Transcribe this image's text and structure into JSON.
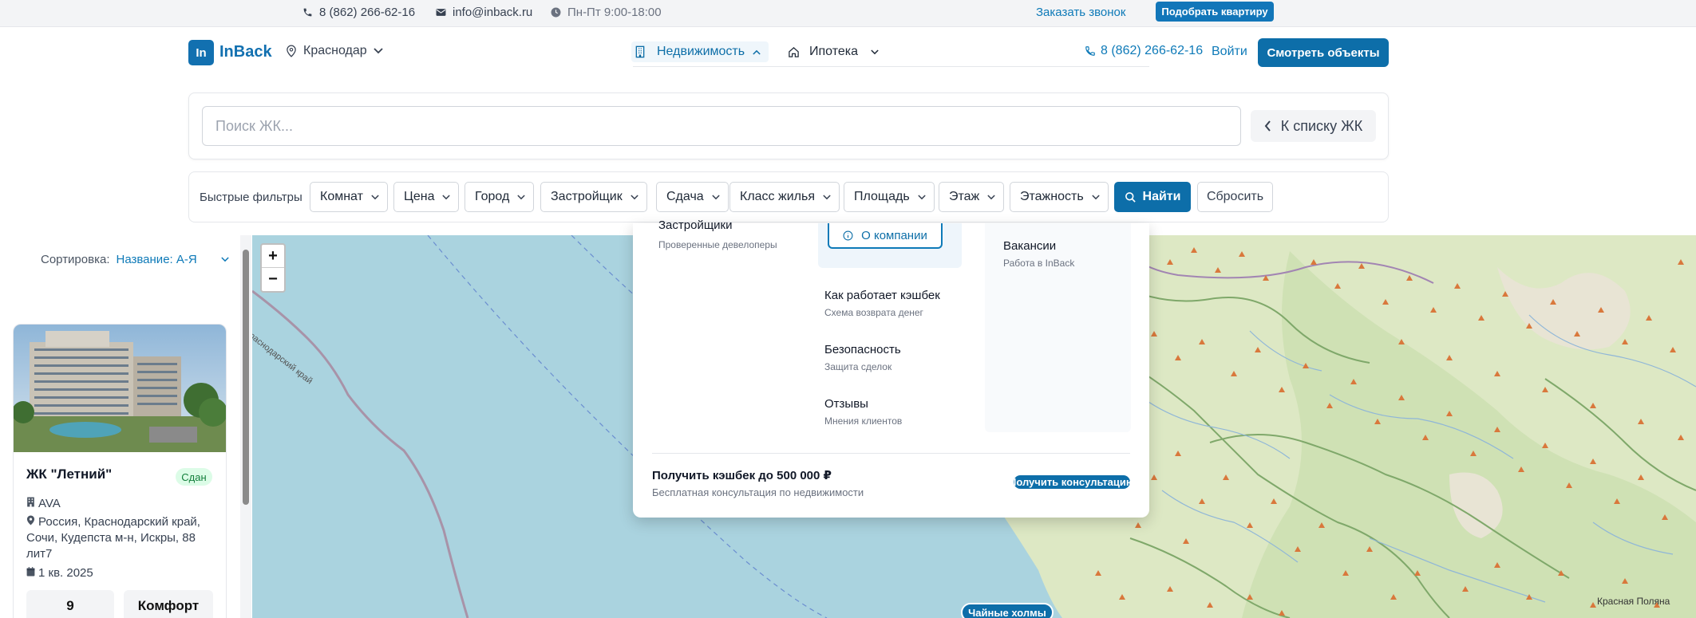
{
  "topbar": {
    "phone": "8 (862) 266-62-16",
    "email": "info@inback.ru",
    "hours": "Пн-Пт 9:00-18:00",
    "callback_link": "Заказать звонок",
    "pick_button": "Подобрать квартиру"
  },
  "header": {
    "logo_mark": "In",
    "logo_text": "InBack",
    "city": "Краснодар",
    "nav_realty": "Недвижимость",
    "nav_mortgage": "Ипотека",
    "phone": "8 (862) 266-62-16",
    "login": "Войти",
    "cta": "Смотреть объекты"
  },
  "search": {
    "placeholder": "Поиск ЖК...",
    "back_button": "К списку ЖК"
  },
  "filters": {
    "label": "Быстрые фильтры",
    "items": [
      "Комнат",
      "Цена",
      "Город",
      "Застройщик",
      "Сдача",
      "Класс жилья",
      "Площадь",
      "Этаж",
      "Этажность"
    ],
    "find": "Найти",
    "reset": "Сбросить"
  },
  "listing": {
    "sort_label": "Сортировка:",
    "sort_value": "Название: А-Я",
    "card": {
      "title": "ЖК \"Летний\"",
      "badge": "Сдан",
      "developer": "AVA",
      "address": "Россия, Краснодарский край, Сочи, Кудепста м-н, Искры, 88 лит7",
      "completion": "1 кв. 2025",
      "stat_count": "9",
      "stat_class": "Комфорт"
    }
  },
  "map": {
    "zoom_in": "+",
    "zoom_out": "−",
    "region_label": "Краснодарский край",
    "town_label": "Красная Поляна",
    "pill_label": "Чайные холмы"
  },
  "dropdown": {
    "developers_title": "Застройщики",
    "developers_sub": "Проверенные девелоперы",
    "about_button": "О компании",
    "cashback_title": "Как работает кэшбек",
    "cashback_sub": "Схема возврата денег",
    "security_title": "Безопасность",
    "security_sub": "Защита сделок",
    "reviews_title": "Отзывы",
    "reviews_sub": "Мнения клиентов",
    "vacancies_title": "Вакансии",
    "vacancies_sub": "Работа в InBack",
    "promo_title": "Получить кэшбек до 500 000 ₽",
    "promo_sub": "Бесплатная консультация по недвижимости",
    "promo_button": "Получить консультацию"
  },
  "colors": {
    "accent": "#0d6ea9",
    "link": "#0e7ab8",
    "badge_bg": "#dcfce7",
    "sea": "#a9d3df",
    "land": "#dfe8c4"
  }
}
